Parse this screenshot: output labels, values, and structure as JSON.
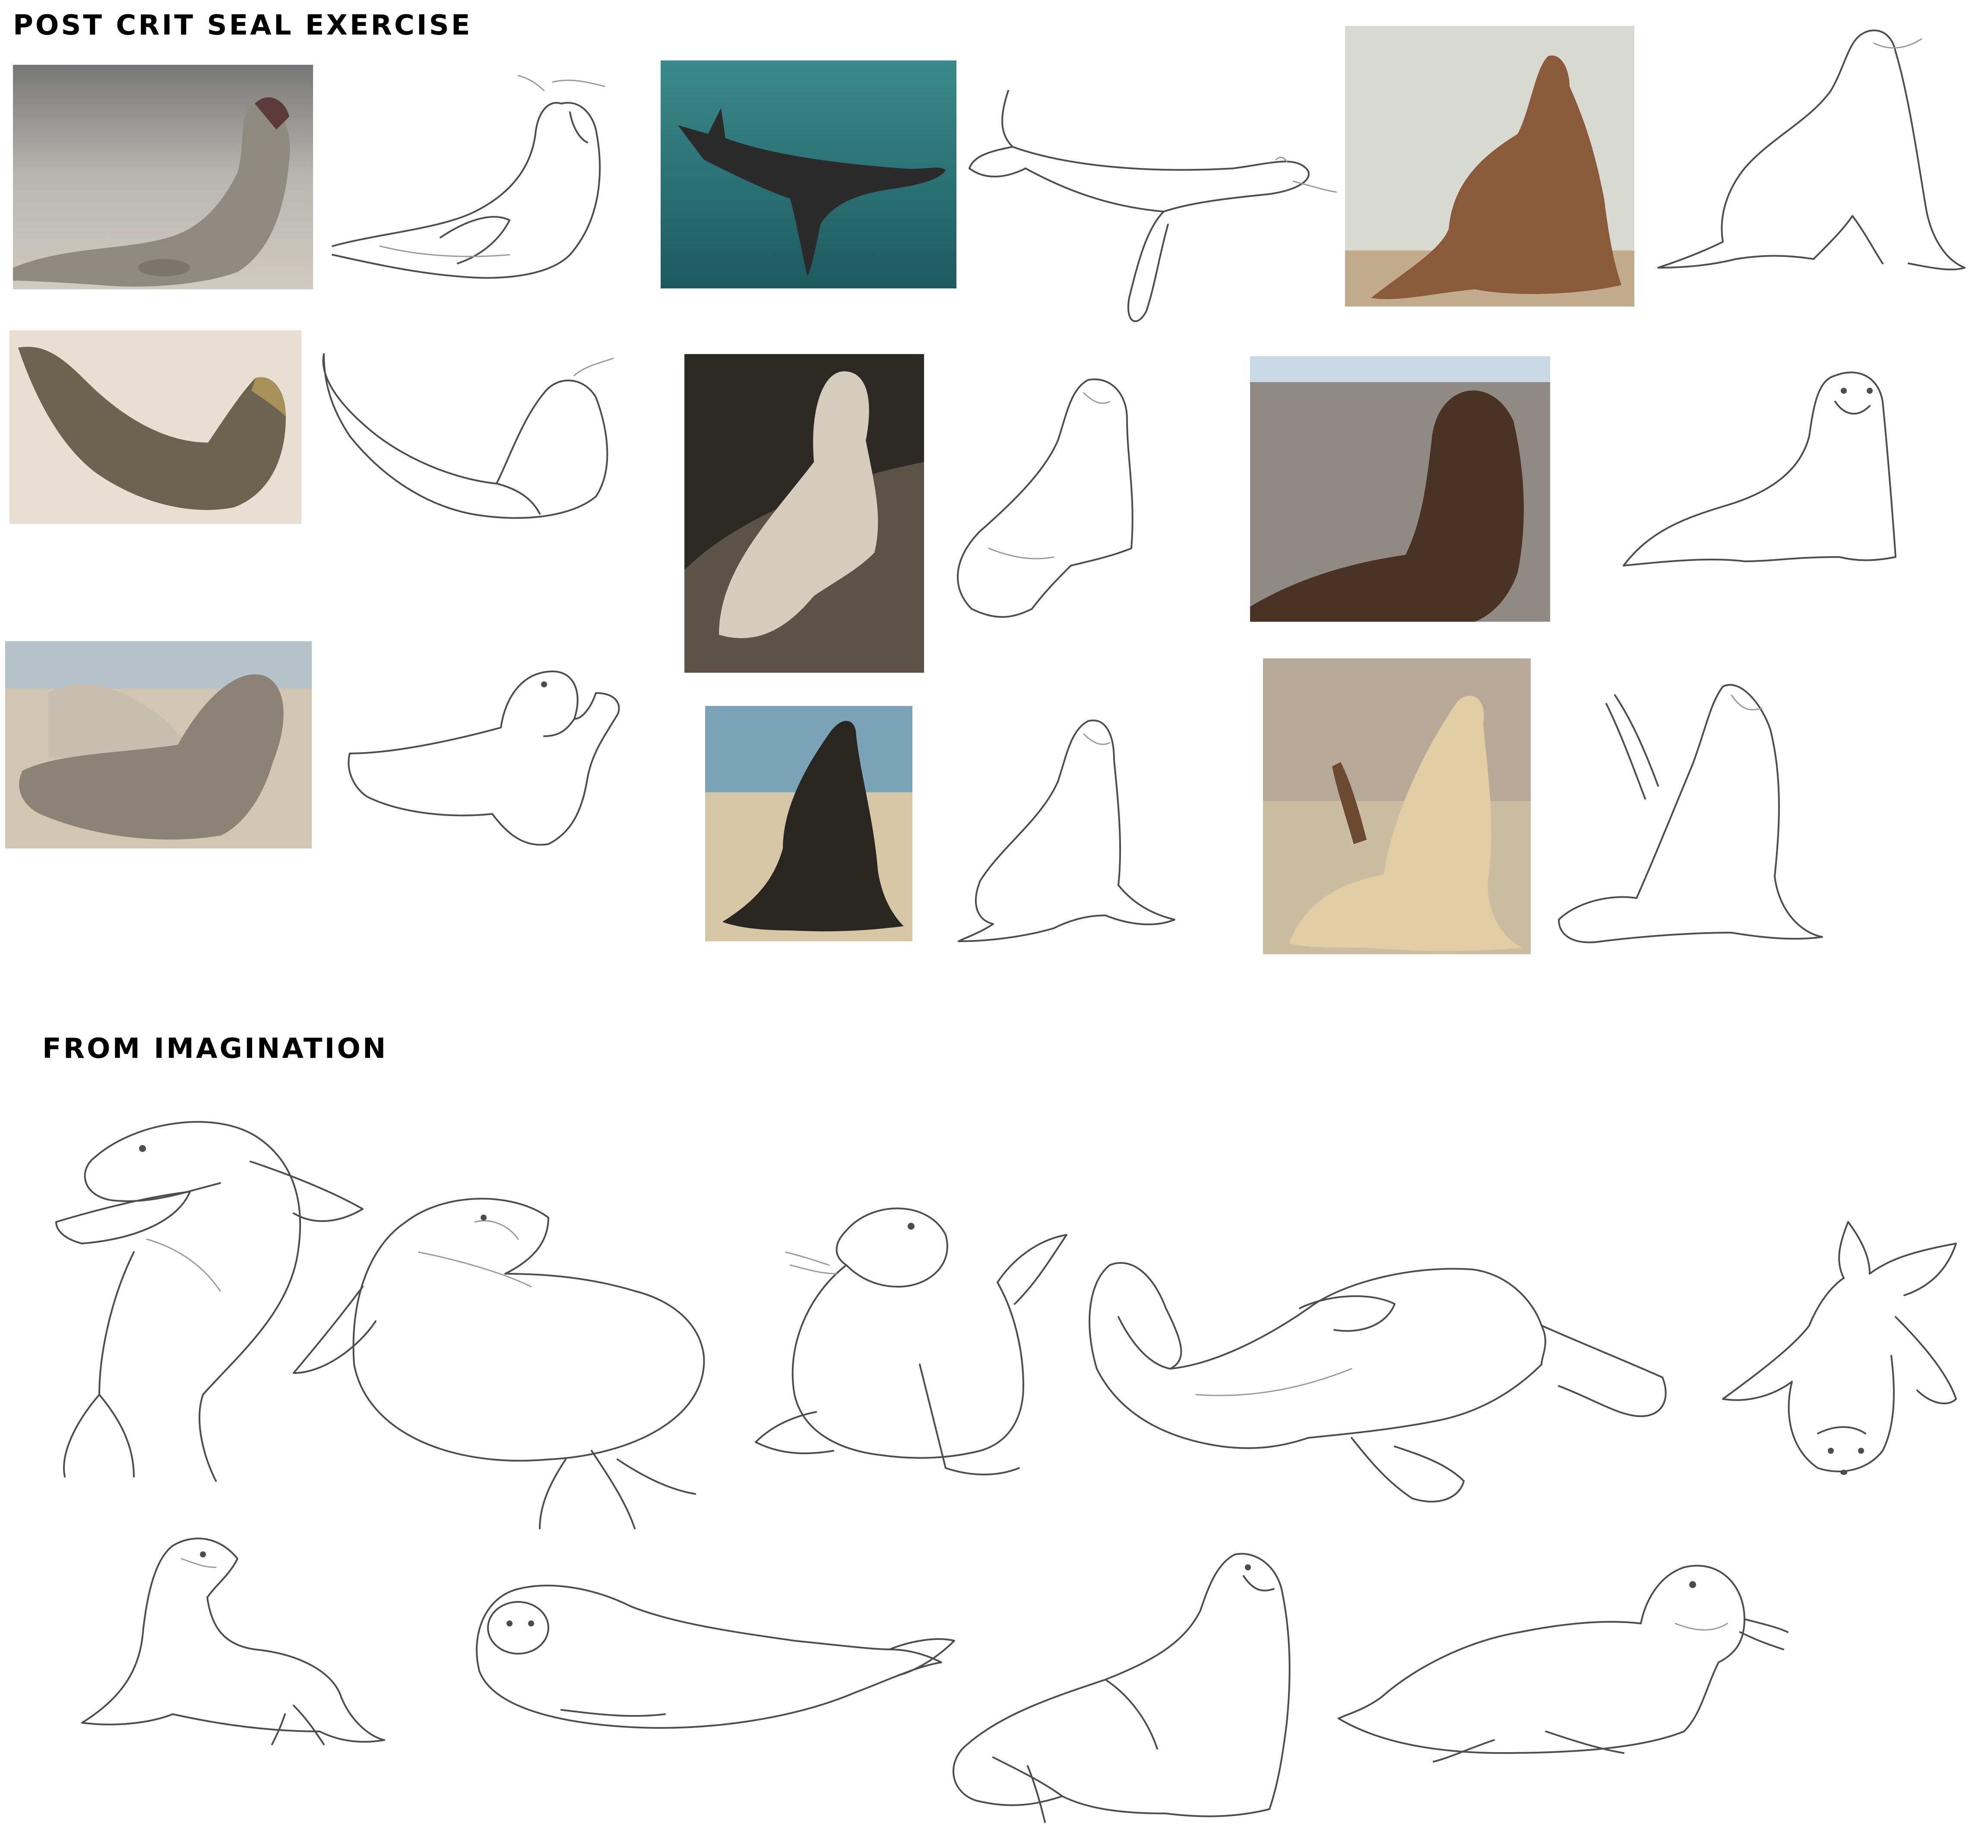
{
  "headings": {
    "top": "POST CRIT SEAL EXERCISE",
    "bottom": "FROM IMAGINATION"
  },
  "photos": [
    {
      "subject": "grey seal yawning on beach",
      "colors": [
        "#9b978c",
        "#cfcac0",
        "#5d5850"
      ]
    },
    {
      "subject": "sea lion swimming underwater",
      "colors": [
        "#2e7a7c",
        "#14474d",
        "#2a2a2a"
      ]
    },
    {
      "subject": "sea lion sitting upright",
      "colors": [
        "#d9dcd4",
        "#8a5a3a",
        "#b08a6a"
      ]
    },
    {
      "subject": "grey seal stretching on sand",
      "colors": [
        "#e3dcd0",
        "#6b6450",
        "#b9a47a"
      ]
    },
    {
      "subject": "sea lion on dark rocks",
      "colors": [
        "#2a2622",
        "#d9cfc0",
        "#6c6052"
      ]
    },
    {
      "subject": "fur seal on rocks",
      "colors": [
        "#9c9890",
        "#4a3224",
        "#6e6a66"
      ]
    },
    {
      "subject": "two grey seals on beach",
      "colors": [
        "#b8c4cc",
        "#d4c8b4",
        "#8e8478"
      ]
    },
    {
      "subject": "dark sea lion on beach",
      "colors": [
        "#7aa3b8",
        "#2a2622",
        "#d8c6a4"
      ]
    },
    {
      "subject": "sea lion waving flipper",
      "colors": [
        "#c8b8a0",
        "#e8d4b0",
        "#6a4a30"
      ]
    }
  ]
}
